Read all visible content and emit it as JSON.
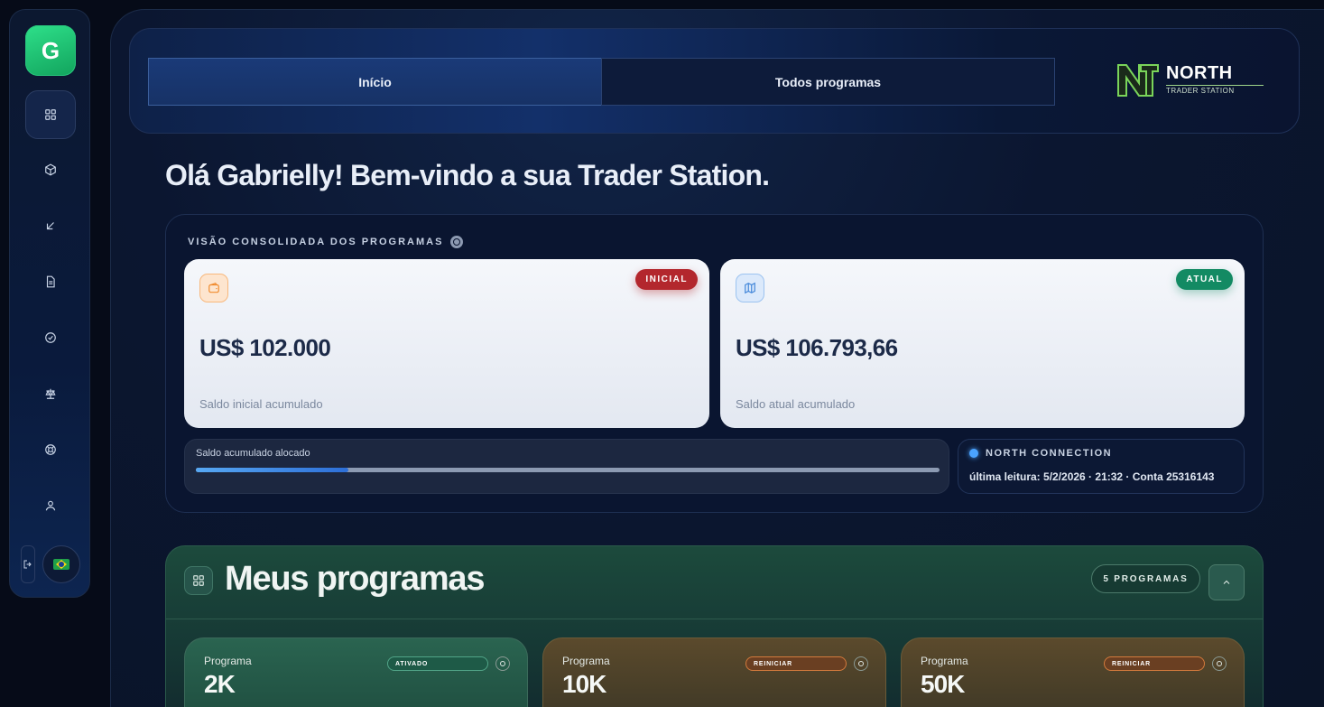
{
  "sidebar": {
    "avatar_letter": "G",
    "items": [
      {
        "name": "dashboard",
        "icon": "grid-icon",
        "active": true
      },
      {
        "name": "programs",
        "icon": "cube-icon",
        "active": false
      },
      {
        "name": "withdraw",
        "icon": "arrow-down-left-icon",
        "active": false
      },
      {
        "name": "documents",
        "icon": "document-icon",
        "active": false
      },
      {
        "name": "verification",
        "icon": "check-circle-icon",
        "active": false
      },
      {
        "name": "rules",
        "icon": "scale-icon",
        "active": false
      },
      {
        "name": "support",
        "icon": "lifebuoy-icon",
        "active": false
      },
      {
        "name": "profile",
        "icon": "user-icon",
        "active": false
      }
    ],
    "logout_icon": "logout-icon",
    "language_flag": "brazil-flag-icon"
  },
  "topbar": {
    "tabs": [
      {
        "label": "Início",
        "active": true
      },
      {
        "label": "Todos programas",
        "active": false
      }
    ],
    "brand_name": "NORTH",
    "brand_sub": "TRADER STATION"
  },
  "greeting": "Olá Gabrielly! Bem-vindo a sua Trader Station.",
  "consolidated": {
    "title": "VISÃO CONSOLIDADA DOS PROGRAMAS",
    "initial": {
      "badge": "INICIAL",
      "value": "US$ 102.000",
      "label": "Saldo inicial acumulado",
      "icon": "wallet-icon"
    },
    "current": {
      "badge": "ATUAL",
      "value": "US$ 106.793,66",
      "label": "Saldo atual acumulado",
      "icon": "map-icon"
    },
    "allocation": {
      "label": "Saldo acumulado alocado",
      "progress_percent": 20.5
    },
    "connection": {
      "title": "NORTH CONNECTION",
      "text": "última leitura: 5/2/2026 · 21:32 · Conta 25316143"
    }
  },
  "programs": {
    "title": "Meus programas",
    "count_label": "5 PROGRAMAS",
    "cards": [
      {
        "label": "Programa",
        "value": "2K",
        "status": "ATIVADO",
        "kind": "active"
      },
      {
        "label": "Programa",
        "value": "10K",
        "status": "REINICIAR",
        "kind": "restart"
      },
      {
        "label": "Programa",
        "value": "50K",
        "status": "REINICIAR",
        "kind": "restart"
      }
    ]
  },
  "colors": {
    "accent_green": "#12a35d",
    "badge_red": "#b3272d",
    "badge_green": "#138a63",
    "progress_blue": "#57a8f3"
  }
}
